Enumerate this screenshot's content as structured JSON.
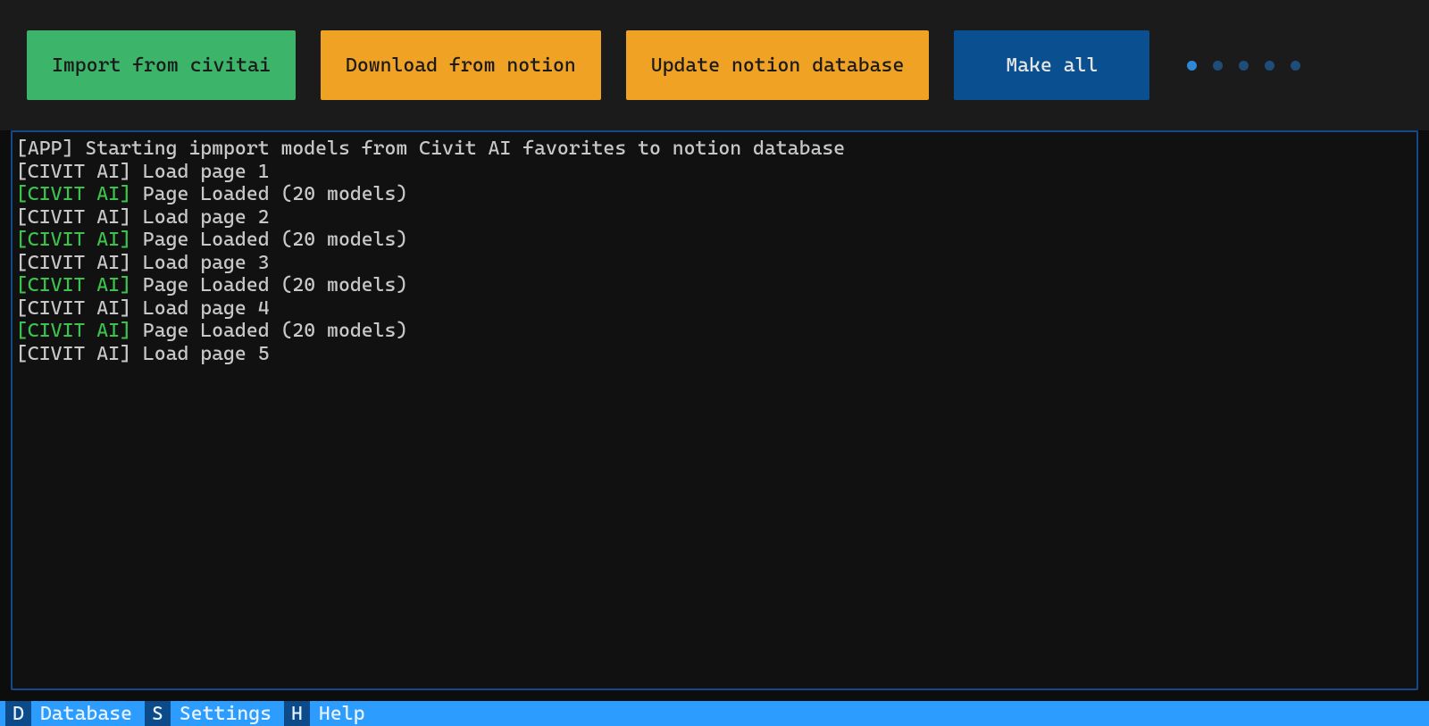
{
  "toolbar": {
    "import_label": "Import from civitai",
    "download_label": "Download from notion",
    "update_label": "Update notion database",
    "make_all_label": "Make all"
  },
  "spinner": {
    "dot_count": 5,
    "active_index": 0
  },
  "log": [
    {
      "prefix": "[APP]",
      "prefix_color": "normal",
      "msg": " Starting ipmport models from Civit AI favorites to notion database"
    },
    {
      "prefix": "[CIVIT AI]",
      "prefix_color": "normal",
      "msg": " Load page 1"
    },
    {
      "prefix": "[CIVIT AI]",
      "prefix_color": "green",
      "msg": " Page Loaded (20 models)"
    },
    {
      "prefix": "[CIVIT AI]",
      "prefix_color": "normal",
      "msg": " Load page 2"
    },
    {
      "prefix": "[CIVIT AI]",
      "prefix_color": "green",
      "msg": " Page Loaded (20 models)"
    },
    {
      "prefix": "[CIVIT AI]",
      "prefix_color": "normal",
      "msg": " Load page 3"
    },
    {
      "prefix": "[CIVIT AI]",
      "prefix_color": "green",
      "msg": " Page Loaded (20 models)"
    },
    {
      "prefix": "[CIVIT AI]",
      "prefix_color": "normal",
      "msg": " Load page 4"
    },
    {
      "prefix": "[CIVIT AI]",
      "prefix_color": "green",
      "msg": " Page Loaded (20 models)"
    },
    {
      "prefix": "[CIVIT AI]",
      "prefix_color": "normal",
      "msg": " Load page 5"
    }
  ],
  "footer": {
    "items": [
      {
        "key": "D",
        "label": "Database"
      },
      {
        "key": "S",
        "label": "Settings"
      },
      {
        "key": "H",
        "label": "Help"
      }
    ]
  }
}
